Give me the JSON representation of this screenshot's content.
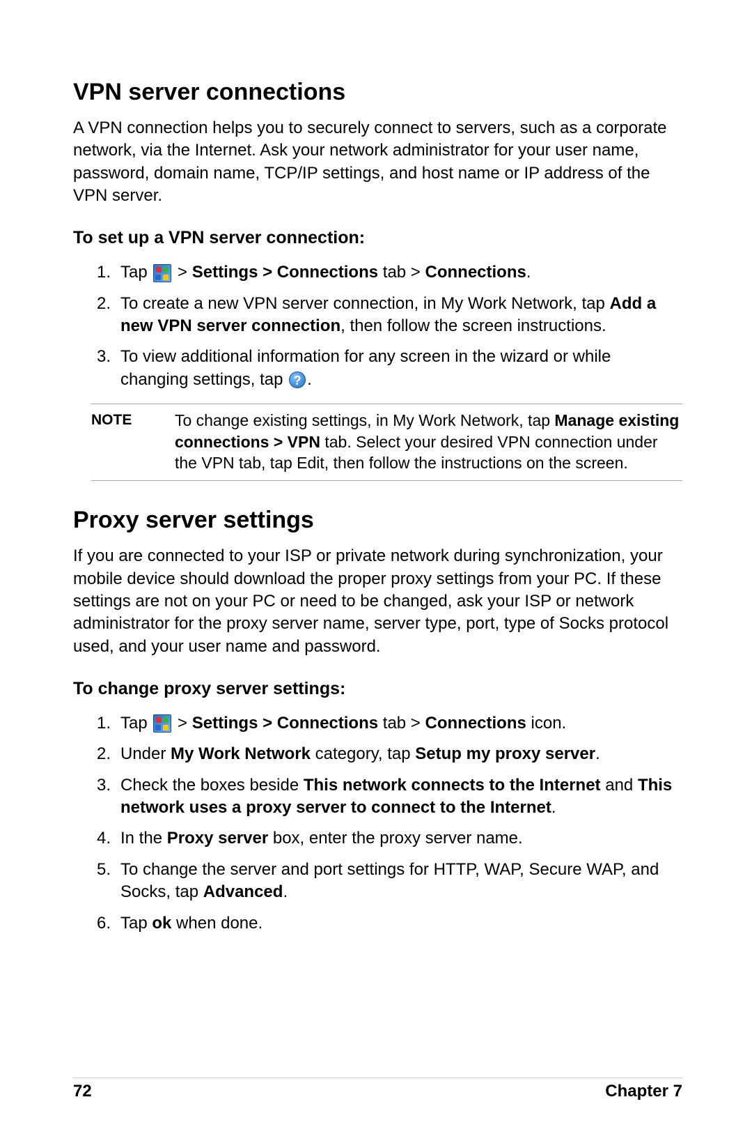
{
  "vpn": {
    "heading": "VPN server connections",
    "intro": "A VPN connection helps you to securely connect to servers, such as a corporate network, via the Internet. Ask your network administrator for your user name, password, domain name, TCP/IP settings, and host name or IP address of the VPN server.",
    "subheading": "To set up a VPN server connection:",
    "steps": {
      "s1a": "Tap ",
      "s1b": " > ",
      "s1c": "Settings > Connections",
      "s1d": " tab > ",
      "s1e": "Connections",
      "s1f": ".",
      "s2a": "To create a new VPN server connection, in My Work Network, tap ",
      "s2b": "Add a new VPN server connection",
      "s2c": ", then follow the screen instructions.",
      "s3a": "To view additional information for any screen in the wizard or while changing settings, tap ",
      "s3b": "."
    },
    "note": {
      "label": "NOTE",
      "t1": "To change existing settings, in My Work Network, tap ",
      "t2": "Manage existing connections > VPN",
      "t3": " tab. Select your desired VPN connection under the VPN tab, tap Edit, then follow the instructions on the screen."
    }
  },
  "proxy": {
    "heading": "Proxy server settings",
    "intro": "If you are connected to your ISP or private network during synchronization, your mobile device should download the proper proxy settings from your PC. If these settings are not on your PC or need to be changed, ask your ISP or network administrator for the proxy server name, server type, port, type of Socks protocol used, and your user name and password.",
    "subheading": "To change proxy server settings:",
    "steps": {
      "s1a": "Tap ",
      "s1b": " > ",
      "s1c": "Settings > Connections",
      "s1d": " tab > ",
      "s1e": "Connections",
      "s1f": " icon.",
      "s2a": "Under ",
      "s2b": "My Work Network",
      "s2c": " category, tap ",
      "s2d": "Setup my proxy server",
      "s2e": ".",
      "s3a": "Check the boxes beside ",
      "s3b": "This network connects to the Internet",
      "s3c": " and ",
      "s3d": "This network uses a proxy server to connect to the Internet",
      "s3e": ".",
      "s4a": "In the ",
      "s4b": "Proxy server",
      "s4c": " box, enter the proxy server name.",
      "s5a": "To change the server and port settings for HTTP, WAP, Secure WAP, and Socks, tap ",
      "s5b": "Advanced",
      "s5c": ".",
      "s6a": "Tap ",
      "s6b": "ok",
      "s6c": " when done."
    }
  },
  "footer": {
    "page": "72",
    "chapter": "Chapter 7"
  }
}
